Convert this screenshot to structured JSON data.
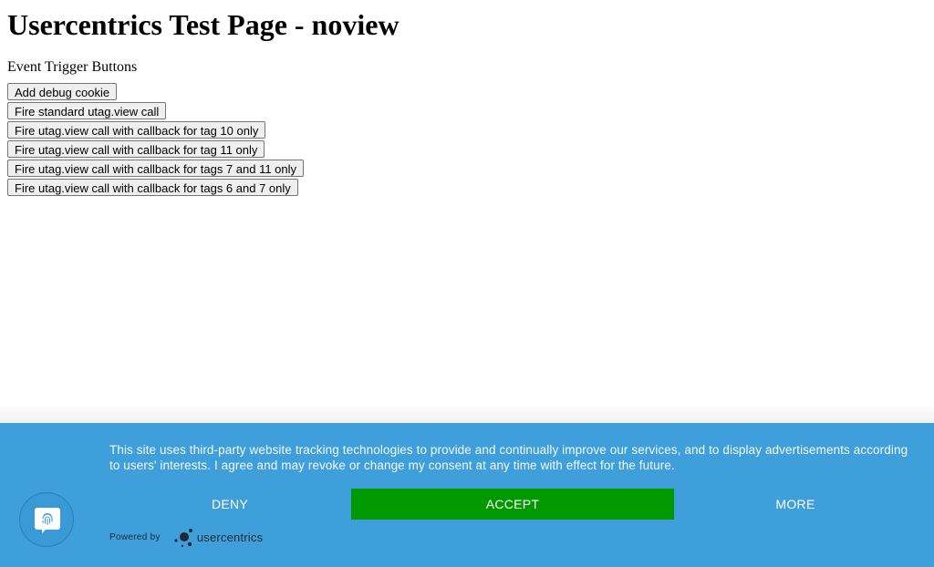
{
  "page": {
    "title": "Usercentrics Test Page - noview",
    "subtitle": "Event Trigger Buttons"
  },
  "buttons": [
    {
      "label": "Add debug cookie"
    },
    {
      "label": "Fire standard utag.view call"
    },
    {
      "label": "Fire utag.view call with callback for tag 10 only"
    },
    {
      "label": "Fire utag.view call with callback for tag 11 only"
    },
    {
      "label": "Fire utag.view call with callback for tags 7 and 11 only"
    },
    {
      "label": "Fire utag.view call with callback for tags 6 and 7 only"
    }
  ],
  "consent_banner": {
    "message": "This site uses third-party website tracking technologies to provide and continually improve our services, and to display advertisements according to users' interests. I agree and may revoke or change my consent at any time with effect for the future.",
    "deny_label": "DENY",
    "accept_label": "ACCEPT",
    "more_label": "MORE",
    "powered_by_label": "Powered by",
    "brand_name": "usercentrics",
    "background_color": "#3e9fdb",
    "accept_color": "#009900",
    "privacy_button_icon": "fingerprint-icon"
  }
}
